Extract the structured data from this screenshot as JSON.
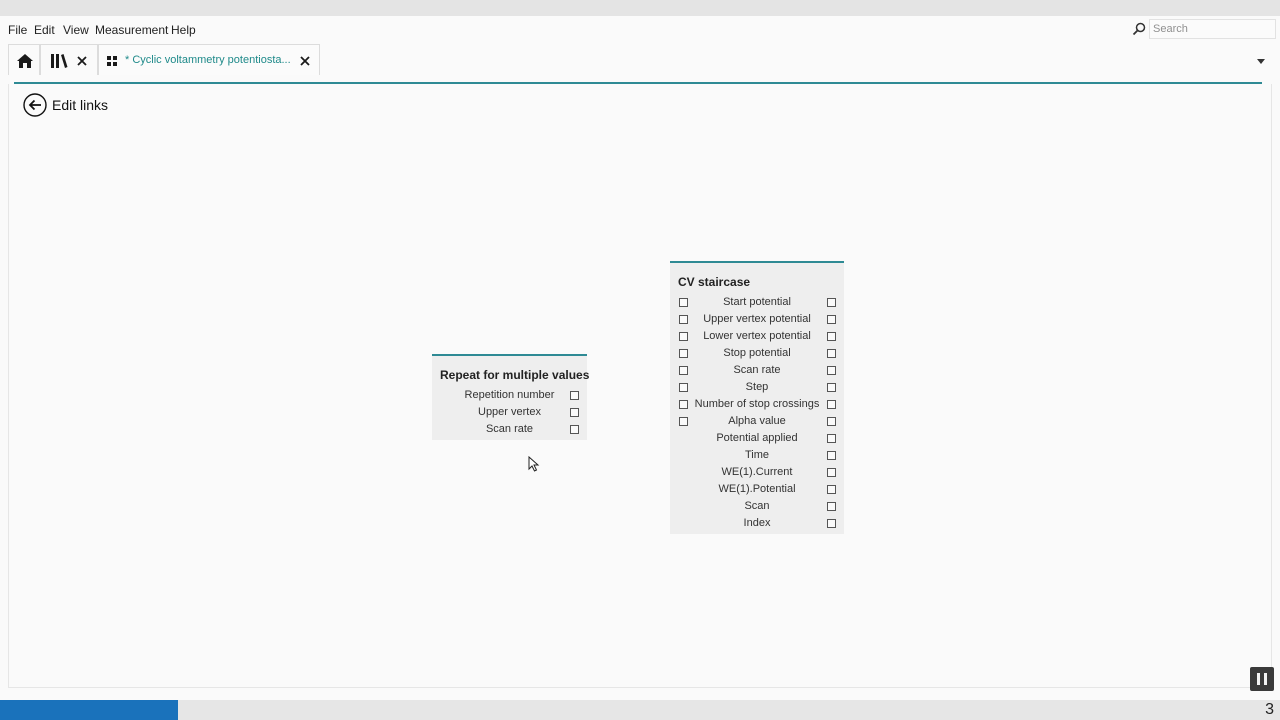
{
  "menu": {
    "items": [
      "File",
      "Edit",
      "View",
      "Measurement",
      "Help"
    ]
  },
  "search": {
    "placeholder": "Search",
    "icon": "search-icon"
  },
  "tabs": {
    "home_icon": "home-icon",
    "library_icon": "library-icon",
    "library_close_icon": "close-icon",
    "method_icon": "grid-icon",
    "method_title": "* Cyclic voltammetry potentiosta...",
    "method_close_icon": "close-icon"
  },
  "header": {
    "back_icon": "back-arrow-icon",
    "title": "Edit links"
  },
  "nodes": {
    "repeat": {
      "title": "Repeat for multiple values",
      "rows": [
        "Repetition number",
        "Upper vertex",
        "Scan rate"
      ]
    },
    "cv": {
      "title": "CV staircase",
      "rows": [
        "Start potential",
        "Upper vertex potential",
        "Lower vertex potential",
        "Stop potential",
        "Scan rate",
        "Step",
        "Number of stop crossings",
        "Alpha value",
        "Potential applied",
        "Time",
        "WE(1).Current",
        "WE(1).Potential",
        "Scan",
        "Index"
      ],
      "input_rows": 8
    }
  },
  "status": {
    "page_number": "3",
    "progress_fraction": 0.139
  },
  "colors": {
    "accent": "#2e8a94",
    "tab_text": "#1f8a8a",
    "progress": "#1a72bb"
  }
}
